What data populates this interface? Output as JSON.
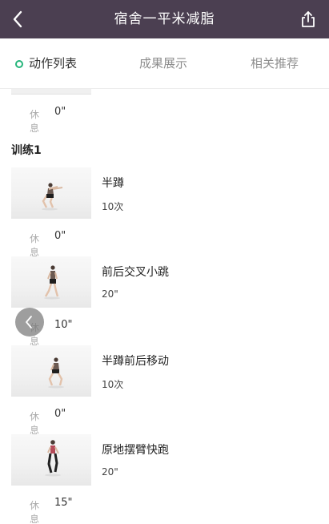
{
  "header": {
    "title": "宿舍一平米减脂",
    "back_icon": "chevron-left-icon",
    "share_icon": "share-icon",
    "background": "#4b3f51"
  },
  "tabs": [
    {
      "label": "动作列表",
      "active": true
    },
    {
      "label": "成果展示",
      "active": false
    },
    {
      "label": "相关推荐",
      "active": false
    }
  ],
  "accent_color": "#26b57b",
  "rest_label": "休息",
  "top_rest": "0\"",
  "section_title": "训练1",
  "exercises": [
    {
      "name": "半蹲",
      "reps": "10次",
      "rest": "0\""
    },
    {
      "name": "前后交叉小跳",
      "reps": "20\"",
      "rest": "10\""
    },
    {
      "name": "半蹲前后移动",
      "reps": "10次",
      "rest": "0\""
    },
    {
      "name": "原地摆臂快跑",
      "reps": "20\"",
      "rest": "15\""
    }
  ],
  "floating_back_icon": "chevron-left-icon"
}
